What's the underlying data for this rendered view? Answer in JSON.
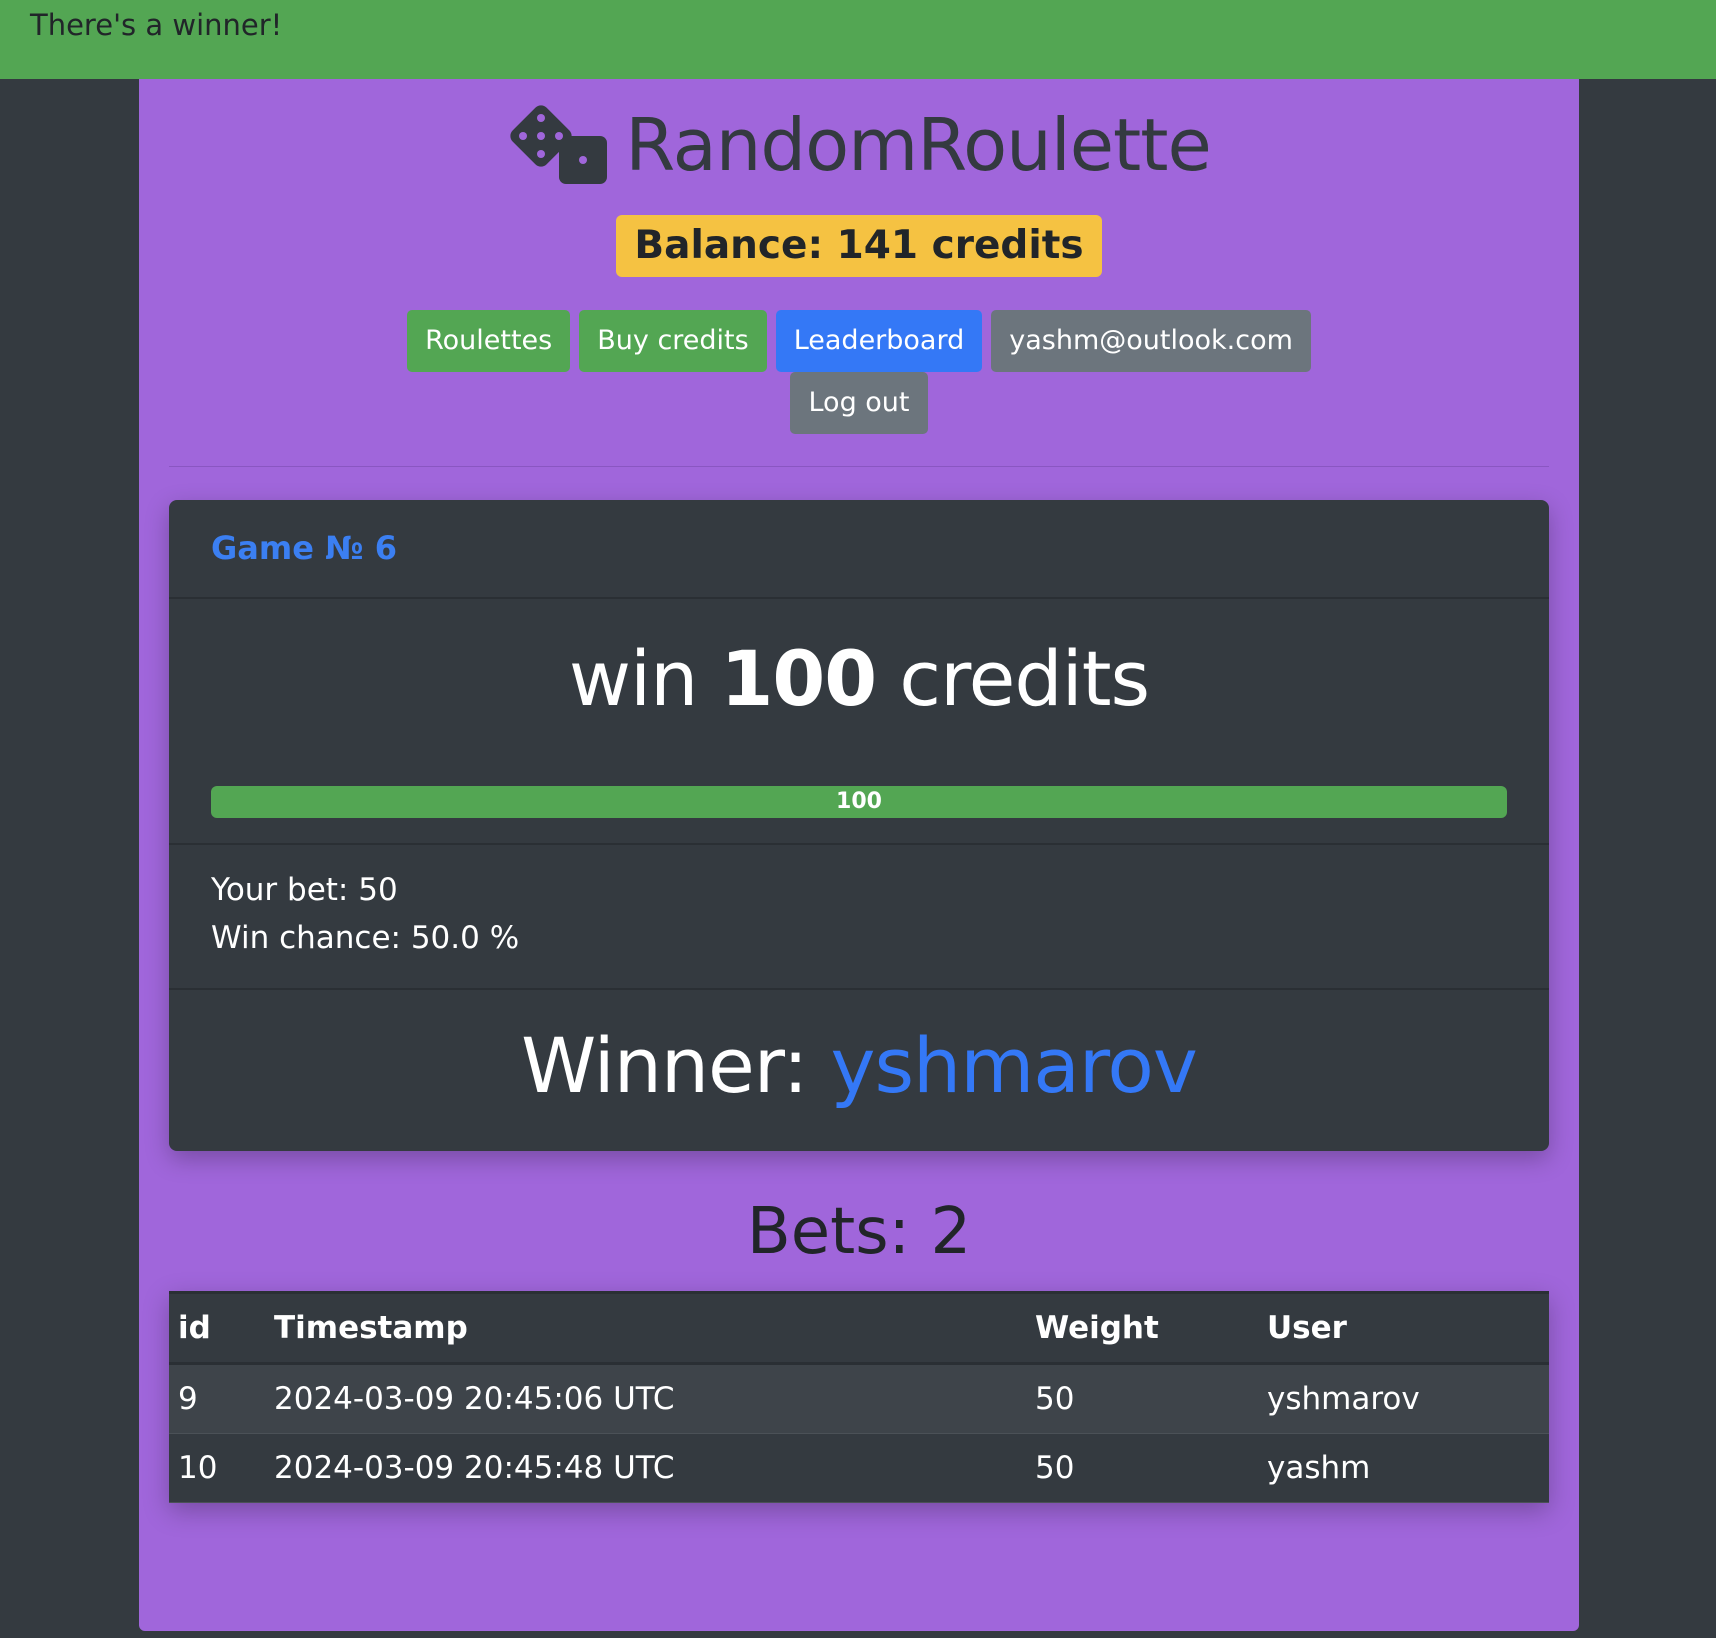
{
  "alert": {
    "text": "There's a winner!"
  },
  "header": {
    "app_title": "RandomRoulette",
    "logo_icon": "dice-icon",
    "balance": "Balance: 141 credits"
  },
  "nav": {
    "roulettes": "Roulettes",
    "buy_credits": "Buy credits",
    "leaderboard": "Leaderboard",
    "user_email": "yashm@outlook.com",
    "log_out": "Log out"
  },
  "game": {
    "title": "Game № 6",
    "prize_prefix": "win",
    "prize_amount": "100",
    "prize_suffix": "credits",
    "progress_label": "100",
    "progress_percent": 100,
    "your_bet": "Your bet: 50",
    "win_chance": "Win chance: 50.0 %",
    "winner_label": "Winner:",
    "winner_name": "yshmarov"
  },
  "bets": {
    "title": "Bets: 2",
    "columns": [
      "id",
      "Timestamp",
      "Weight",
      "User"
    ],
    "rows": [
      {
        "id": "9",
        "timestamp": "2024-03-09 20:45:06 UTC",
        "weight": "50",
        "user": "yshmarov"
      },
      {
        "id": "10",
        "timestamp": "2024-03-09 20:45:48 UTC",
        "weight": "50",
        "user": "yashm"
      }
    ]
  },
  "colors": {
    "alert_bg": "#53a653",
    "page_bg": "#343a40",
    "panel_bg": "#a066db",
    "balance_bg": "#f5c242",
    "btn_green": "#53a653",
    "btn_blue": "#3478f6",
    "btn_gray": "#6c757d",
    "link_blue": "#3478f6"
  }
}
